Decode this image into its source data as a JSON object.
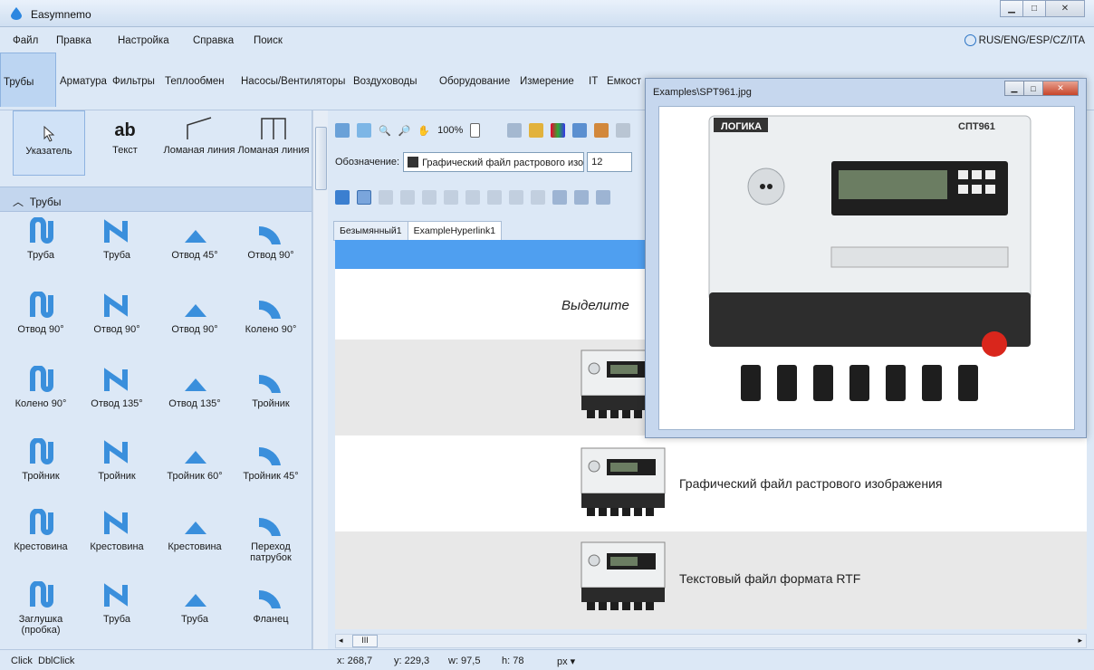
{
  "window": {
    "title": "Easymnemo"
  },
  "menu": {
    "items": [
      "Файл",
      "Правка",
      "Настройка",
      "Справка",
      "Поиск"
    ],
    "language": "RUS/ENG/ESP/CZ/ITA"
  },
  "categories": [
    "Трубы",
    "Арматура",
    "Фильтры",
    "Теплообмен",
    "Насосы/Вентиляторы",
    "Воздуховоды",
    "Оборудование",
    "Измерение",
    "IT",
    "Емкост"
  ],
  "tools": [
    "Указатель",
    "Текст",
    "Ломаная линия",
    "Ломаная линия"
  ],
  "tool_text_glyph": "ab",
  "section": {
    "title": "Трубы"
  },
  "pipes": [
    "Труба",
    "Труба",
    "Отвод 45°",
    "Отвод 90°",
    "Отвод 90°",
    "Отвод 90°",
    "Отвод 90°",
    "Колено 90°",
    "Колено 90°",
    "Отвод 135°",
    "Отвод 135°",
    "Тройник",
    "Тройник",
    "Тройник",
    "Тройник 60°",
    "Тройник 45°",
    "Крестовина",
    "Крестовина",
    "Крестовина",
    "Переход патрубок",
    "Заглушка (пробка)",
    "Труба",
    "Труба",
    "Фланец"
  ],
  "toolbar": {
    "zoom": "100%"
  },
  "designation": {
    "label": "Обозначение:",
    "value": "Графический файл растрового изоб",
    "number": "12"
  },
  "doc_tabs": [
    "Безымянный1",
    "ExampleHyperlink1"
  ],
  "doc": {
    "prompt": "Выделите",
    "rows": [
      "Графический файл растрового изображения",
      "Текстовый файл формата RTF"
    ]
  },
  "image_window": {
    "title": "Examples\\SPT961.jpg",
    "brand": "ЛОГИКА",
    "model": "СПТ961"
  },
  "hscroll_glyph": "III",
  "status": {
    "click": "Click",
    "dblclick": "DblClick",
    "x": "x: 268,7",
    "y": "y: 229,3",
    "w": "w: 97,5",
    "h": "h: 78",
    "units": "px ▾"
  }
}
